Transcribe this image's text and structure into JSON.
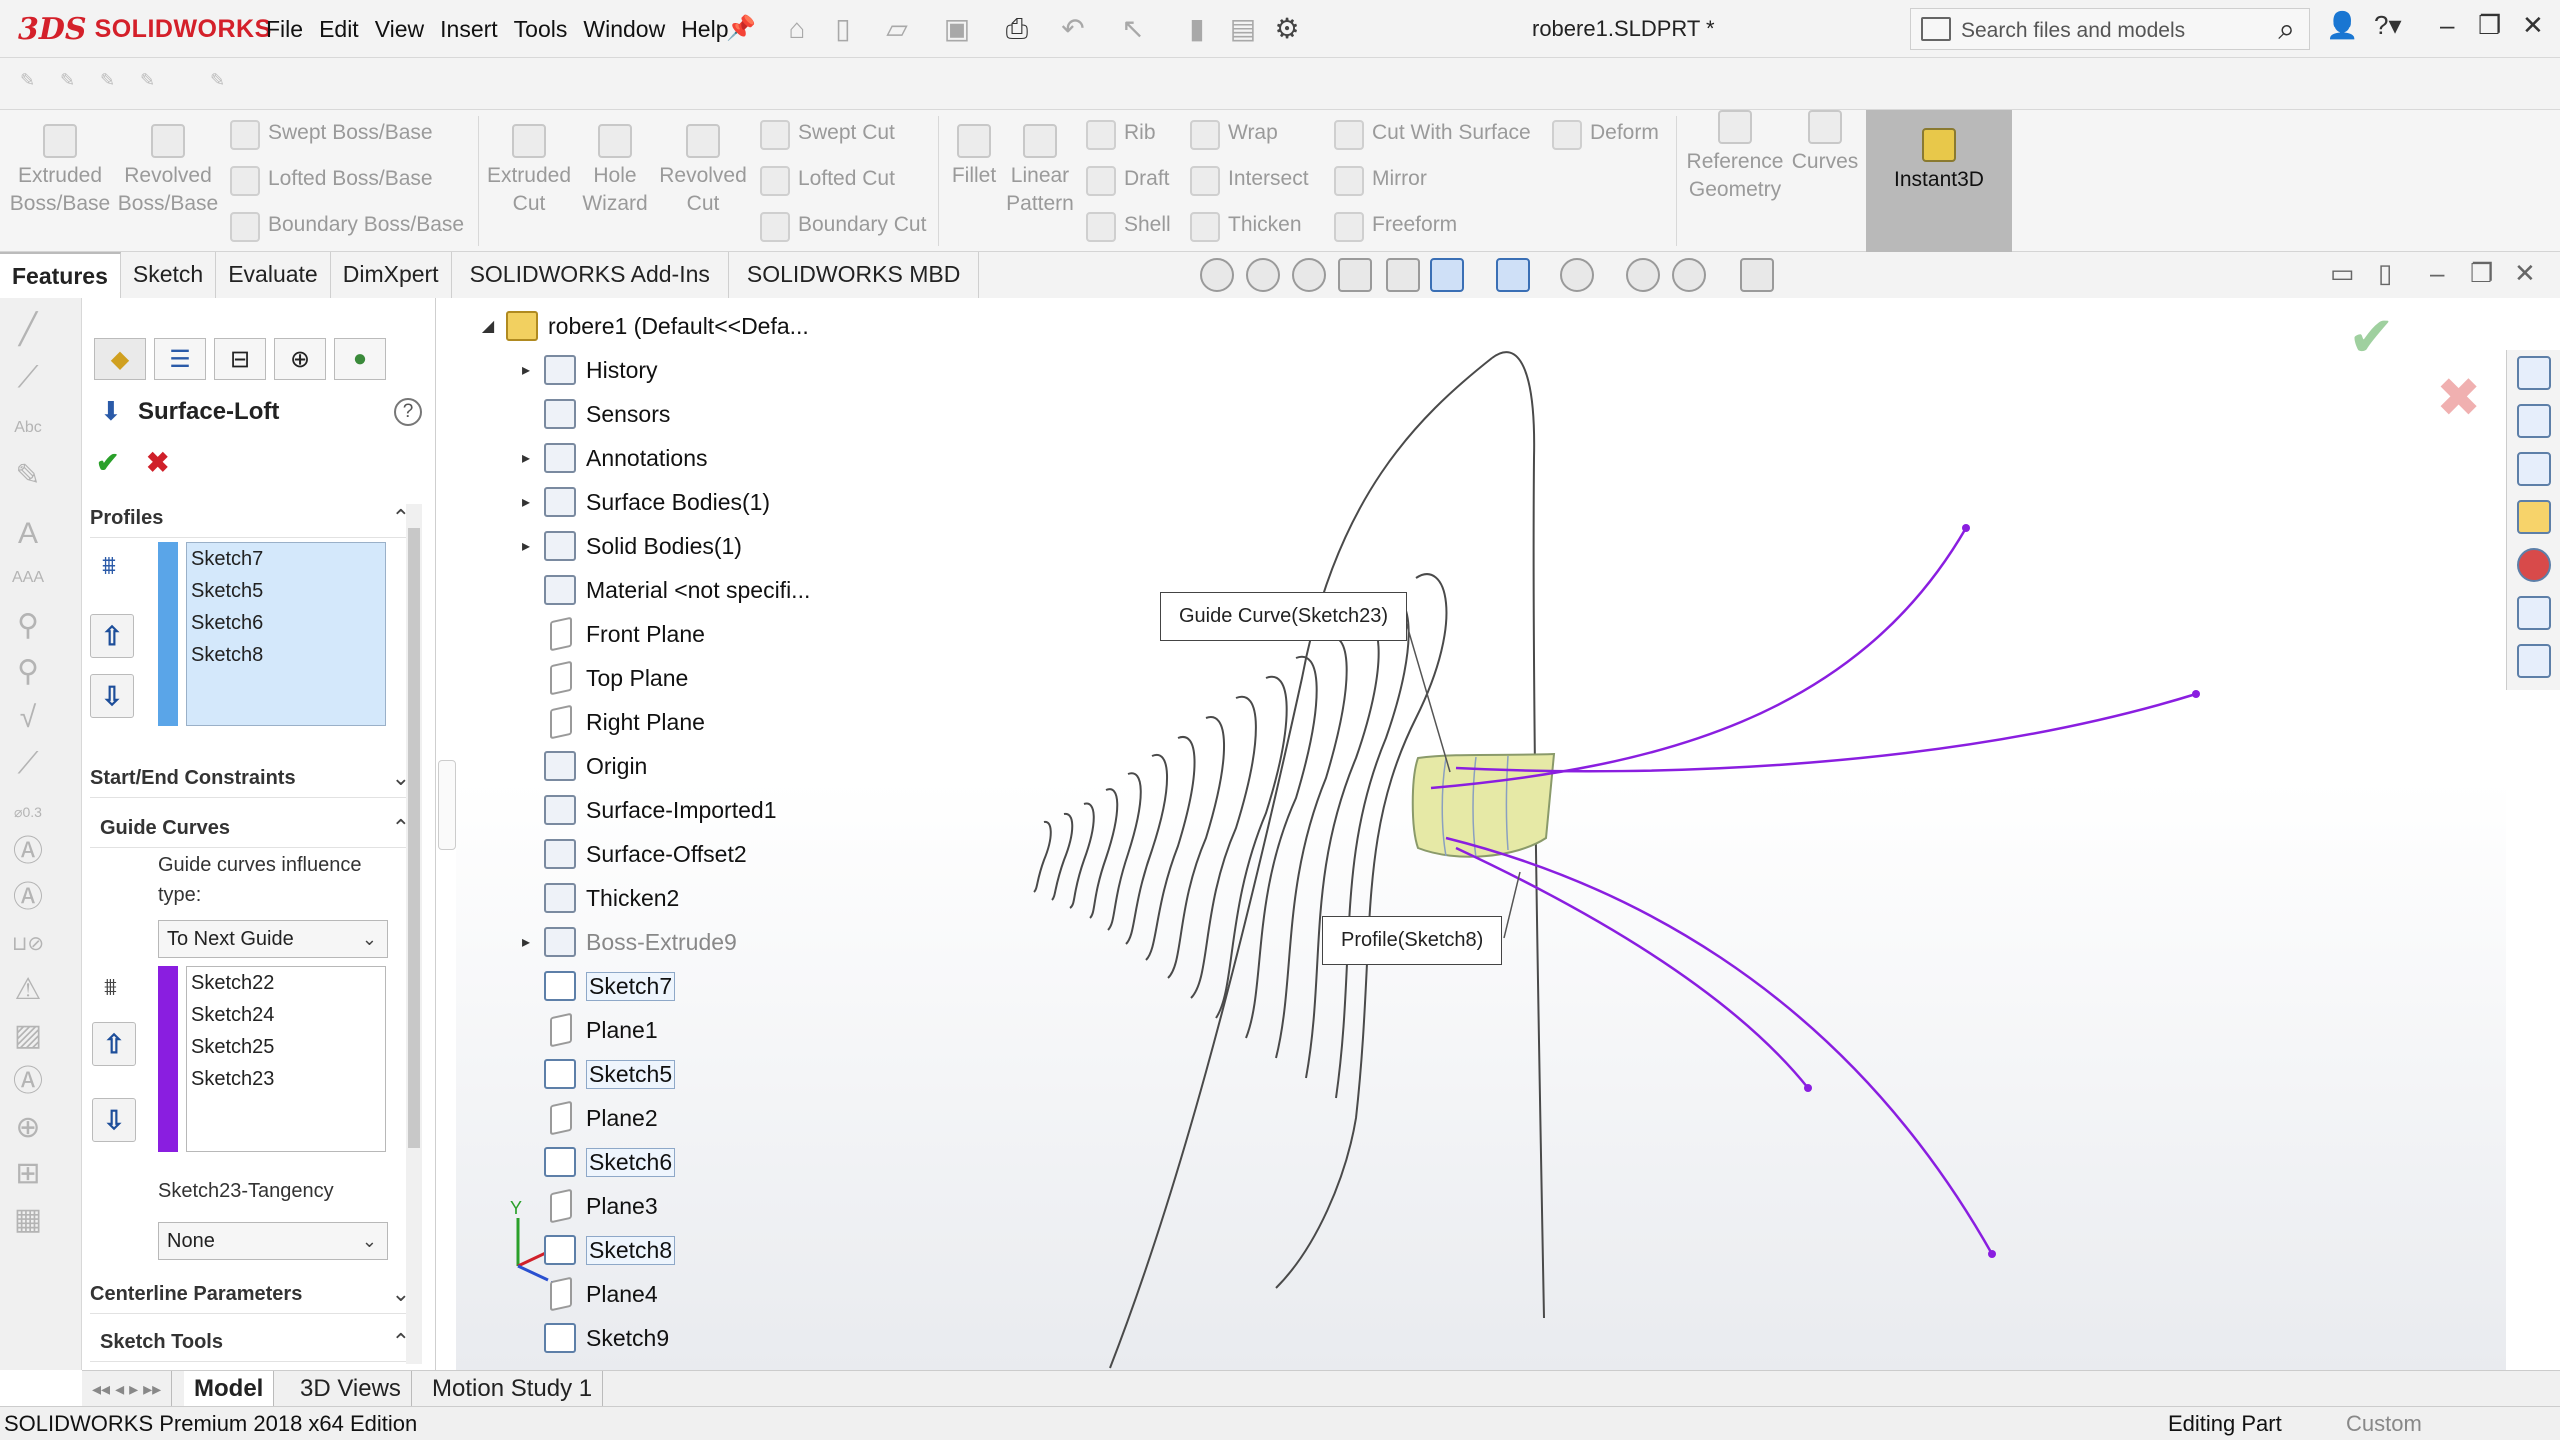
{
  "app": {
    "logo_mark": "3DS",
    "logo_text": "SOLIDWORKS",
    "document_title": "robere1.SLDPRT *",
    "menus": [
      "File",
      "Edit",
      "View",
      "Insert",
      "Tools",
      "Window",
      "Help"
    ],
    "search_placeholder": "Search files and models"
  },
  "command_manager": {
    "extruded_boss": "Extruded Boss/Base",
    "revolved_boss": "Revolved Boss/Base",
    "swept_boss": "Swept Boss/Base",
    "lofted_boss": "Lofted Boss/Base",
    "boundary_boss": "Boundary Boss/Base",
    "extruded_cut": "Extruded Cut",
    "hole_wizard": "Hole Wizard",
    "revolved_cut": "Revolved Cut",
    "swept_cut": "Swept Cut",
    "lofted_cut": "Lofted Cut",
    "boundary_cut": "Boundary Cut",
    "fillet": "Fillet",
    "linear_pattern": "Linear Pattern",
    "rib": "Rib",
    "draft": "Draft",
    "shell": "Shell",
    "wrap": "Wrap",
    "intersect": "Intersect",
    "thicken": "Thicken",
    "cut_with_surface": "Cut With Surface",
    "deform": "Deform",
    "mirror": "Mirror",
    "freeform": "Freeform",
    "reference_geometry": "Reference Geometry",
    "curves": "Curves",
    "instant3d": "Instant3D"
  },
  "tabs": [
    "Features",
    "Sketch",
    "Evaluate",
    "DimXpert",
    "SOLIDWORKS Add-Ins",
    "SOLIDWORKS MBD"
  ],
  "property_manager": {
    "title": "Surface-Loft",
    "help": "?",
    "ok": "✔",
    "cancel": "✖",
    "profiles_header": "Profiles",
    "profiles": [
      "Sketch7",
      "Sketch5",
      "Sketch6",
      "Sketch8"
    ],
    "start_end_header": "Start/End Constraints",
    "guide_curves_header": "Guide Curves",
    "guide_influence_label": "Guide curves influence type:",
    "guide_influence_value": "To Next Guide",
    "guide_curves": [
      "Sketch22",
      "Sketch24",
      "Sketch25",
      "Sketch23"
    ],
    "tangency_label": "Sketch23-Tangency",
    "tangency_value": "None",
    "centerline_header": "Centerline Parameters",
    "sketch_tools_header": "Sketch Tools",
    "accent_profiles": "#5aa5e8",
    "accent_guides": "#8a1ee0"
  },
  "tree": {
    "root": "robere1  (Default<<Defa...",
    "items": [
      {
        "label": "History",
        "kind": "folder",
        "expand": true
      },
      {
        "label": "Sensors",
        "kind": "folder",
        "expand": false
      },
      {
        "label": "Annotations",
        "kind": "folder",
        "expand": true
      },
      {
        "label": "Surface Bodies(1)",
        "kind": "folder",
        "expand": true
      },
      {
        "label": "Solid Bodies(1)",
        "kind": "folder",
        "expand": true
      },
      {
        "label": "Material <not specifi...",
        "kind": "material",
        "expand": false
      },
      {
        "label": "Front Plane",
        "kind": "plane",
        "expand": false
      },
      {
        "label": "Top Plane",
        "kind": "plane",
        "expand": false
      },
      {
        "label": "Right Plane",
        "kind": "plane",
        "expand": false
      },
      {
        "label": "Origin",
        "kind": "origin",
        "expand": false
      },
      {
        "label": "Surface-Imported1",
        "kind": "feature",
        "expand": false
      },
      {
        "label": "Surface-Offset2",
        "kind": "feature",
        "expand": false
      },
      {
        "label": "Thicken2",
        "kind": "feature",
        "expand": false
      },
      {
        "label": "Boss-Extrude9",
        "kind": "feature-grey",
        "expand": true
      },
      {
        "label": "Sketch7",
        "kind": "sketch-hl",
        "expand": false
      },
      {
        "label": "Plane1",
        "kind": "plane",
        "expand": false
      },
      {
        "label": "Sketch5",
        "kind": "sketch-hl",
        "expand": false
      },
      {
        "label": "Plane2",
        "kind": "plane",
        "expand": false
      },
      {
        "label": "Sketch6",
        "kind": "sketch-hl",
        "expand": false
      },
      {
        "label": "Plane3",
        "kind": "plane",
        "expand": false
      },
      {
        "label": "Sketch8",
        "kind": "sketch-hl",
        "expand": false
      },
      {
        "label": "Plane4",
        "kind": "plane",
        "expand": false
      },
      {
        "label": "Sketch9",
        "kind": "sketch",
        "expand": false
      }
    ]
  },
  "graphics": {
    "callout_guide": "Guide Curve(Sketch23)",
    "callout_profile": "Profile(Sketch8)",
    "triad_y": "Y",
    "triad_x": "X",
    "triad_z": "Z",
    "guide_color": "#8a1ee0",
    "profile_color": "#4a4a4a",
    "preview_color": "#e6e9a6"
  },
  "bottom_tabs": [
    "Model",
    "3D Views",
    "Motion Study 1"
  ],
  "status": {
    "edition": "SOLIDWORKS Premium 2018 x64 Edition",
    "mode": "Editing Part",
    "units": "Custom"
  }
}
